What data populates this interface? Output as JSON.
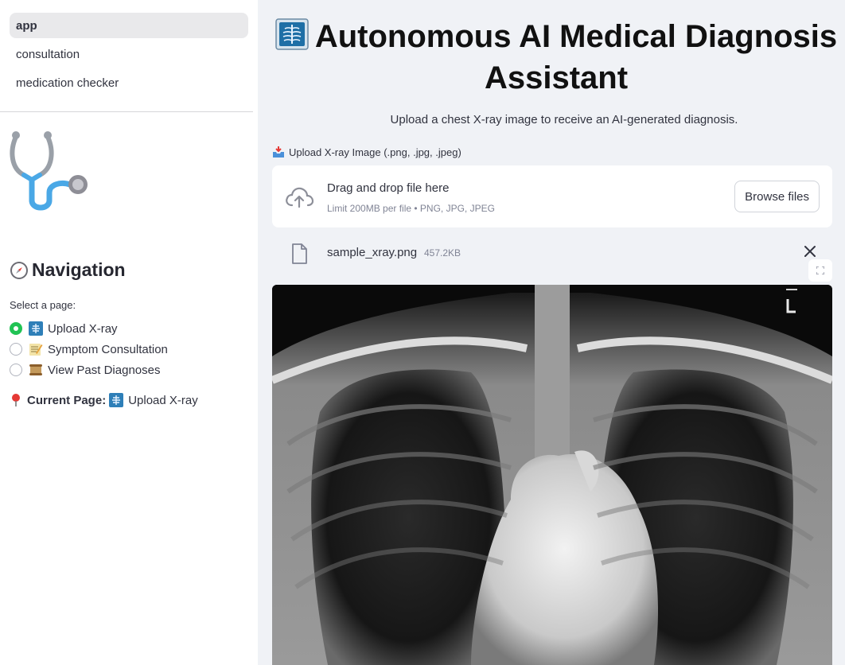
{
  "sidebar": {
    "pages": [
      {
        "label": "app",
        "active": true
      },
      {
        "label": "consultation",
        "active": false
      },
      {
        "label": "medication checker",
        "active": false
      }
    ],
    "nav_heading": "Navigation",
    "select_label": "Select a page:",
    "radio_options": [
      {
        "label": "Upload X-ray",
        "checked": true
      },
      {
        "label": "Symptom Consultation",
        "checked": false
      },
      {
        "label": "View Past Diagnoses",
        "checked": false
      }
    ],
    "current_page_label": "Current Page:",
    "current_page_value": "Upload X-ray"
  },
  "main": {
    "title": "Autonomous AI Medical Diagnosis Assistant",
    "subtitle": "Upload a chest X-ray image to receive an AI-generated diagnosis.",
    "uploader": {
      "label": "Upload X-ray Image (.png, .jpg, .jpeg)",
      "drop_text": "Drag and drop file here",
      "limit_text": "Limit 200MB per file • PNG, JPG, JPEG",
      "browse_label": "Browse files"
    },
    "file": {
      "name": "sample_xray.png",
      "size": "457.2KB"
    }
  },
  "colors": {
    "accent_green": "#21c354",
    "sidebar_bg": "#ffffff",
    "main_bg": "#f0f2f6"
  }
}
